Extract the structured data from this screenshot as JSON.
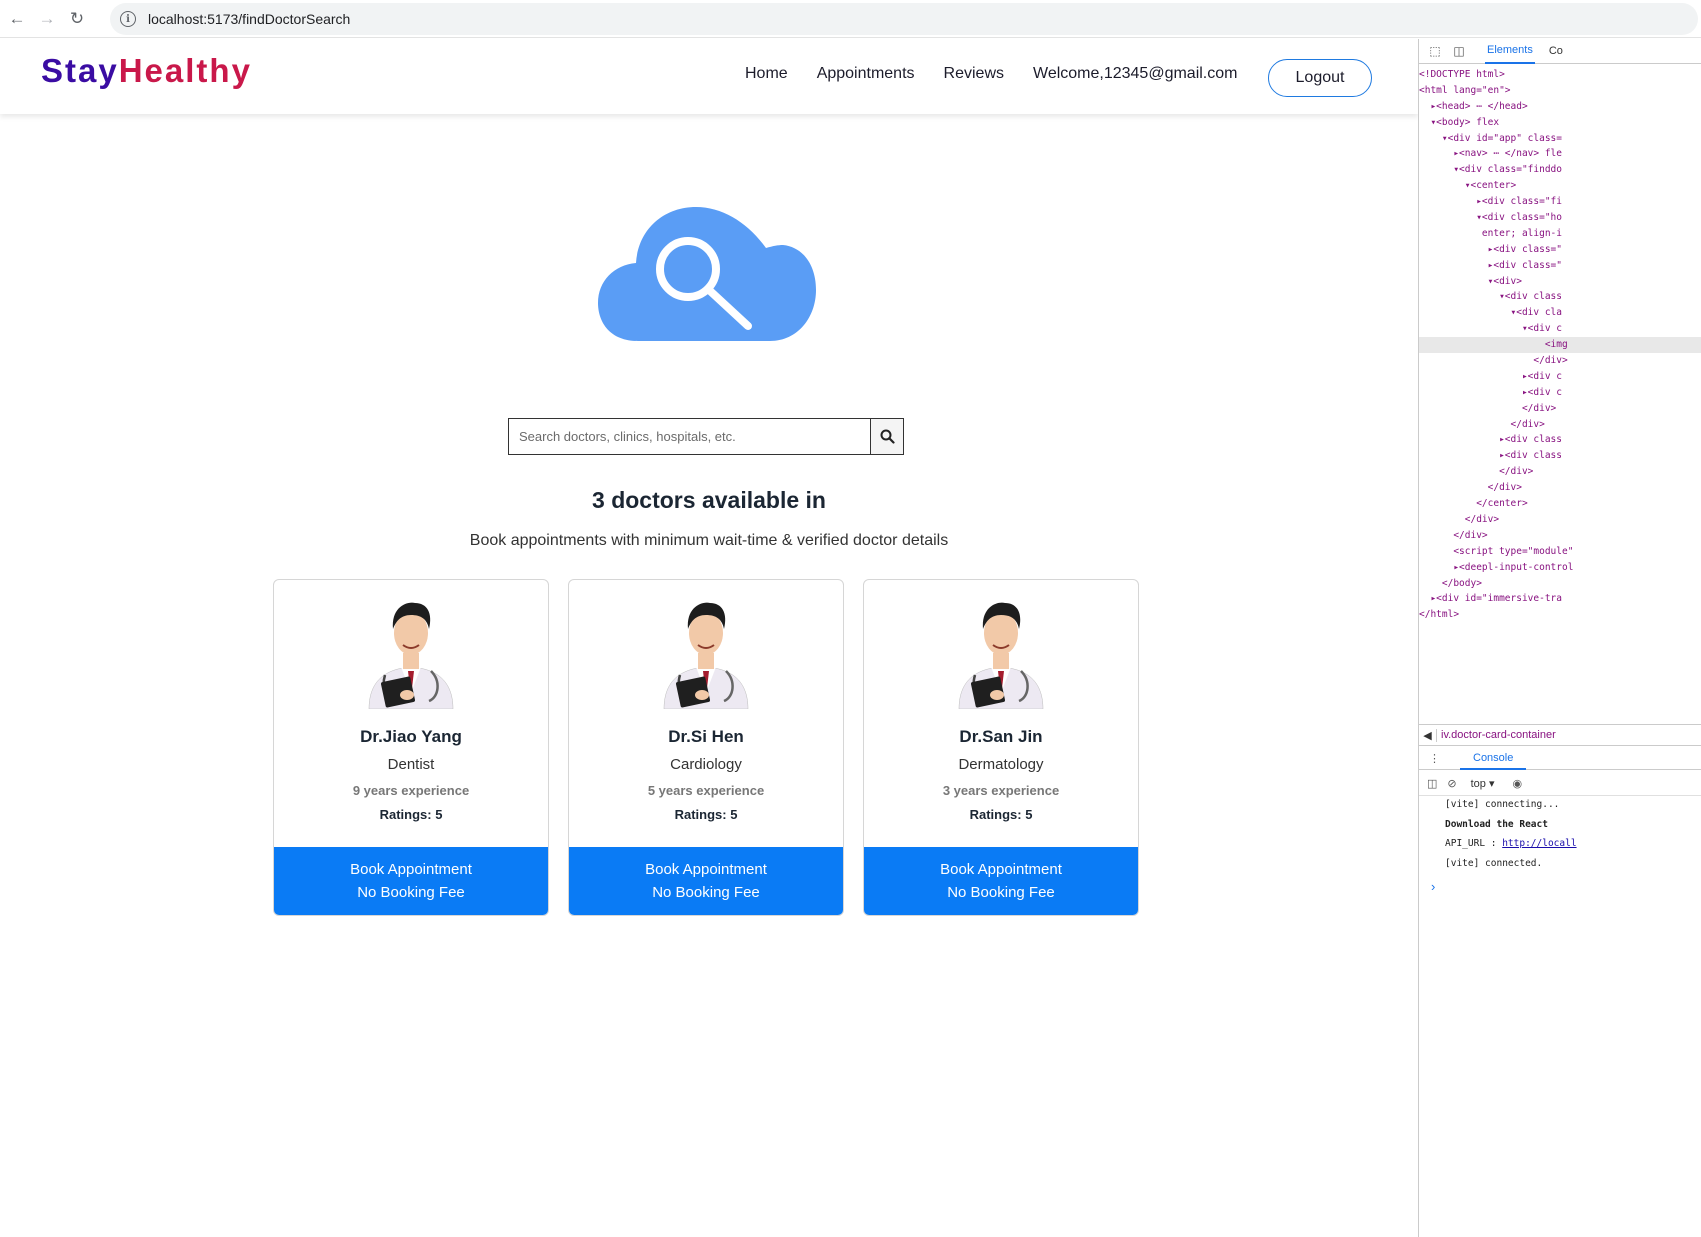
{
  "browser": {
    "url": "localhost:5173/findDoctorSearch"
  },
  "brand": {
    "part1": "Stay",
    "part2": "Healthy",
    "color1": "#3a0ca3",
    "color2": "#c9184a"
  },
  "nav": {
    "home": "Home",
    "appointments": "Appointments",
    "reviews": "Reviews",
    "welcome": "Welcome,12345@gmail.com",
    "logout": "Logout"
  },
  "search": {
    "placeholder": "Search doctors, clinics, hospitals, etc."
  },
  "results": {
    "heading": "3 doctors available in",
    "subheading": "Book appointments with minimum wait-time & verified doctor details"
  },
  "doctors": [
    {
      "name": "Dr.Jiao Yang",
      "specialty": "Dentist",
      "experience": "9 years experience",
      "ratings": "Ratings: 5",
      "book_line1": "Book Appointment",
      "book_line2": "No Booking Fee"
    },
    {
      "name": "Dr.Si Hen",
      "specialty": "Cardiology",
      "experience": "5 years experience",
      "ratings": "Ratings: 5",
      "book_line1": "Book Appointment",
      "book_line2": "No Booking Fee"
    },
    {
      "name": "Dr.San Jin",
      "specialty": "Dermatology",
      "experience": "3 years experience",
      "ratings": "Ratings: 5",
      "book_line1": "Book Appointment",
      "book_line2": "No Booking Fee"
    }
  ],
  "colors": {
    "accent": "#0a7bf5",
    "hero_cloud": "#5a9df5"
  },
  "devtools": {
    "tab_elements": "Elements",
    "tab_more": "Co",
    "dom_lines": [
      "<!DOCTYPE html>",
      "<html lang=\"en\">",
      "  ▸<head> ⋯ </head>",
      "  ▾<body> flex",
      "    ▾<div id=\"app\" class=",
      "      ▸<nav> ⋯ </nav> fle",
      "      ▾<div class=\"finddo",
      "        ▾<center>",
      "          ▸<div class=\"fi",
      "          ▾<div class=\"ho",
      "           enter; align-i",
      "            ▸<div class=\"",
      "            ▸<div class=\"",
      "            ▾<div>",
      "              ▾<div class",
      "                ▾<div cla",
      "                  ▾<div c",
      "                      <img",
      "                    </div>",
      "                  ▸<div c",
      "                  ▸<div c",
      "                  </div>",
      "                </div>",
      "              ▸<div class",
      "              ▸<div class",
      "              </div>",
      "            </div>",
      "          </center>",
      "        </div>",
      "      </div>",
      "      <script type=\"module\"",
      "      ▸<deepl-input-control",
      "    </body>",
      "  ▸<div id=\"immersive-tra",
      "</html>"
    ],
    "breadcrumb": "iv.doctor-card-container",
    "console_tab": "Console",
    "context": "top ▾",
    "console_lines": [
      "[vite] connecting...",
      "Download the React",
      "API_URL : ",
      "[vite] connected."
    ],
    "api_link": "http://locall"
  }
}
